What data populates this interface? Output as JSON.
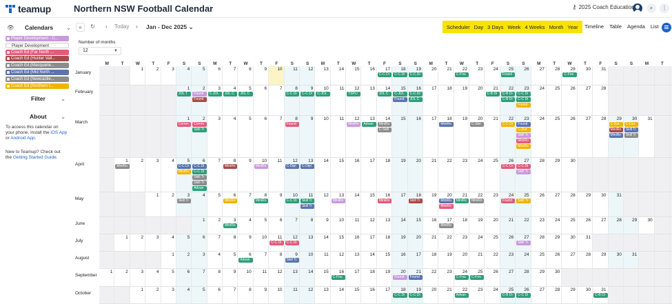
{
  "app": {
    "logo_text": "teamup",
    "title": "Northern NSW Football Calendar",
    "user": "2025 Coach Education"
  },
  "sidebar": {
    "calendars_label": "Calendars",
    "calendars": [
      {
        "name": "Player Development - C...",
        "color": "#c99adb"
      },
      {
        "name": "Player Development",
        "color": "#ffffff",
        "text": "#333"
      },
      {
        "name": "Coach Ed (Far North ...",
        "color": "#e35b7a"
      },
      {
        "name": "Coach Ed (Hunter Vall...",
        "color": "#a84a4a"
      },
      {
        "name": "Coach Ed (Macquarie...",
        "color": "#8c8c8c"
      },
      {
        "name": "Coach Ed (Mid North ...",
        "color": "#5a74ae"
      },
      {
        "name": "Coach Ed (Newcastle...",
        "color": "#8c8c8c"
      },
      {
        "name": "Coach Ed (Northern I...",
        "color": "#f0b400"
      }
    ],
    "filter_label": "Filter",
    "about_label": "About",
    "about_text1": "To access this calendar on your phone, install the ",
    "about_link1": "iOS App",
    "about_or": " or ",
    "about_link2": "Android App",
    "about_text2": "New to Teamup? Check out the ",
    "about_link3": "Getting Started Guide"
  },
  "toolbar": {
    "today": "Today",
    "range": "Jan - Dec 2025",
    "views_highlight": [
      "Scheduler",
      "Day",
      "3 Days",
      "Week",
      "4 Weeks",
      "Month",
      "Year"
    ],
    "views_other": [
      "Timeline",
      "Table",
      "Agenda",
      "List"
    ]
  },
  "months_control": {
    "label": "Number of months",
    "value": "12"
  },
  "day_headers": [
    "M",
    "T",
    "W",
    "T",
    "F",
    "S",
    "S",
    "M",
    "T",
    "W",
    "T",
    "F",
    "S",
    "S",
    "M",
    "T",
    "W",
    "T",
    "F",
    "S",
    "S",
    "M",
    "T",
    "W",
    "T",
    "F",
    "S",
    "S",
    "M",
    "T",
    "W",
    "T",
    "F",
    "S",
    "S",
    "M",
    "T",
    "W"
  ],
  "months": [
    {
      "name": "January",
      "offset": 2,
      "days": 31
    },
    {
      "name": "February",
      "offset": 5,
      "days": 28
    },
    {
      "name": "March",
      "offset": 5,
      "days": 31
    },
    {
      "name": "April",
      "offset": 1,
      "days": 30
    },
    {
      "name": "May",
      "offset": 3,
      "days": 31
    },
    {
      "name": "June",
      "offset": 6,
      "days": 30
    },
    {
      "name": "July",
      "offset": 1,
      "days": 31
    },
    {
      "name": "August",
      "offset": 4,
      "days": 31
    },
    {
      "name": "September",
      "offset": 0,
      "days": 30
    },
    {
      "name": "October",
      "offset": 2,
      "days": 31
    }
  ],
  "today": {
    "month": 0,
    "day": 10
  },
  "events": [
    {
      "m": 0,
      "d": 17,
      "t": "C-C Di",
      "c": "#2e9e78"
    },
    {
      "m": 0,
      "d": 18,
      "t": "C-C Di",
      "c": "#2e9e78"
    },
    {
      "m": 0,
      "d": 19,
      "t": "C-C Di",
      "c": "#2e9e78"
    },
    {
      "m": 0,
      "d": 22,
      "t": "C-Fou",
      "c": "#2e9e78"
    },
    {
      "m": 0,
      "d": 25,
      "t": "Found",
      "c": "#2e9e78"
    },
    {
      "m": 0,
      "d": 29,
      "t": "C-Fou",
      "c": "#2e9e78"
    },
    {
      "m": 1,
      "d": 1,
      "t": "JDL T",
      "c": "#2e9e78"
    },
    {
      "m": 1,
      "d": 2,
      "t": "Found",
      "c": "#c99adb"
    },
    {
      "m": 1,
      "d": 2,
      "t": "Found",
      "c": "#a84a4a",
      "r": 1
    },
    {
      "m": 1,
      "d": 3,
      "t": "C-JDL",
      "c": "#2e9e78"
    },
    {
      "m": 1,
      "d": 4,
      "t": "JDL C",
      "c": "#2e9e78"
    },
    {
      "m": 1,
      "d": 5,
      "t": "JDL C",
      "c": "#2e9e78"
    },
    {
      "m": 1,
      "d": 8,
      "t": "C-C Di",
      "c": "#2e9e78"
    },
    {
      "m": 1,
      "d": 9,
      "t": "C-C Di",
      "c": "#2e9e78"
    },
    {
      "m": 1,
      "d": 10,
      "t": "C-JDL",
      "c": "#2e9e78"
    },
    {
      "m": 1,
      "d": 12,
      "t": "TSP/J",
      "c": "#2e9e78"
    },
    {
      "m": 1,
      "d": 14,
      "t": "JDL C",
      "c": "#2e9e78"
    },
    {
      "m": 1,
      "d": 15,
      "t": "C-JDL",
      "c": "#2e9e78"
    },
    {
      "m": 1,
      "d": 15,
      "t": "Found",
      "c": "#5a74ae",
      "r": 1
    },
    {
      "m": 1,
      "d": 16,
      "t": "C-C Di",
      "c": "#2e9e78"
    },
    {
      "m": 1,
      "d": 16,
      "t": "JDL C",
      "c": "#2e9e78",
      "r": 1
    },
    {
      "m": 1,
      "d": 21,
      "t": "C-B Di",
      "c": "#2e9e78"
    },
    {
      "m": 1,
      "d": 22,
      "t": "C-B Di",
      "c": "#2e9e78"
    },
    {
      "m": 1,
      "d": 22,
      "t": "C-B Di",
      "c": "#2e9e78",
      "r": 1
    },
    {
      "m": 1,
      "d": 23,
      "t": "C-C Di",
      "c": "#2e9e78"
    },
    {
      "m": 1,
      "d": 23,
      "t": "C-C Di",
      "c": "#2e9e78",
      "r": 1
    },
    {
      "m": 1,
      "d": 23,
      "t": "Found",
      "c": "#f0b400",
      "r": 2
    },
    {
      "m": 2,
      "d": 1,
      "t": "Comm",
      "c": "#e35b7a"
    },
    {
      "m": 2,
      "d": 2,
      "t": "Comm",
      "c": "#e35b7a"
    },
    {
      "m": 2,
      "d": 2,
      "t": "Skill Tr",
      "c": "#2e9e78",
      "r": 1
    },
    {
      "m": 2,
      "d": 8,
      "t": "Found",
      "c": "#e35b7a"
    },
    {
      "m": 2,
      "d": 12,
      "t": "MiniRo",
      "c": "#c99adb"
    },
    {
      "m": 2,
      "d": 13,
      "t": "Advan",
      "c": "#2e9e78"
    },
    {
      "m": 2,
      "d": 14,
      "t": "MiniRo",
      "c": "#8c8c8c"
    },
    {
      "m": 2,
      "d": 14,
      "t": "C-Skill",
      "c": "#8c8c8c",
      "r": 1
    },
    {
      "m": 2,
      "d": 18,
      "t": "MiniRo",
      "c": "#5a74ae"
    },
    {
      "m": 2,
      "d": 20,
      "t": "C-Skil",
      "c": "#8c8c8c"
    },
    {
      "m": 2,
      "d": 22,
      "t": "C-C Di",
      "c": "#f0b400"
    },
    {
      "m": 2,
      "d": 23,
      "t": "Found",
      "c": "#5a74ae"
    },
    {
      "m": 2,
      "d": 23,
      "t": "C-Dut",
      "c": "#f0b400",
      "r": 1
    },
    {
      "m": 2,
      "d": 23,
      "t": "Skill Tr",
      "c": "#c99adb",
      "r": 2
    },
    {
      "m": 2,
      "d": 23,
      "t": "MiniRo",
      "c": "#e35b7a",
      "r": 3
    },
    {
      "m": 2,
      "d": 23,
      "t": "MiniRo",
      "c": "#f0b400",
      "r": 4
    },
    {
      "m": 2,
      "d": 29,
      "t": "C-Dut",
      "c": "#f0b400"
    },
    {
      "m": 2,
      "d": 29,
      "t": "MiniRo",
      "c": "#a84a4a",
      "r": 1
    },
    {
      "m": 2,
      "d": 29,
      "t": "MiniRo",
      "c": "#5a74ae",
      "r": 2
    },
    {
      "m": 2,
      "d": 30,
      "t": "C-Dut",
      "c": "#f0b400"
    },
    {
      "m": 2,
      "d": 30,
      "t": "Skill Tr",
      "c": "#5a74ae",
      "r": 1
    },
    {
      "m": 2,
      "d": 30,
      "t": "Skill Tr",
      "c": "#8c8c8c",
      "r": 2
    },
    {
      "m": 3,
      "d": 1,
      "t": "MiniRo",
      "c": "#8c8c8c"
    },
    {
      "m": 3,
      "d": 5,
      "t": "C-C Di",
      "c": "#5a74ae"
    },
    {
      "m": 3,
      "d": 5,
      "t": "MiniRo",
      "c": "#f0b400",
      "r": 1
    },
    {
      "m": 3,
      "d": 6,
      "t": "C-C Di",
      "c": "#5a74ae"
    },
    {
      "m": 3,
      "d": 6,
      "t": "C-C Di",
      "c": "#2e9e78",
      "r": 1
    },
    {
      "m": 3,
      "d": 6,
      "t": "Skill Tr",
      "c": "#8c8c8c",
      "r": 2
    },
    {
      "m": 3,
      "d": 6,
      "t": "Skill Tr",
      "c": "#8c8c8c",
      "r": 3
    },
    {
      "m": 3,
      "d": 6,
      "t": "Advan",
      "c": "#2e9e78",
      "r": 4
    },
    {
      "m": 3,
      "d": 8,
      "t": "MiniRo",
      "c": "#a84a4a"
    },
    {
      "m": 3,
      "d": 10,
      "t": "MiniRo",
      "c": "#c99adb"
    },
    {
      "m": 3,
      "d": 12,
      "t": "C-Dipl",
      "c": "#5a74ae"
    },
    {
      "m": 3,
      "d": 13,
      "t": "C-Dipl",
      "c": "#5a74ae"
    },
    {
      "m": 3,
      "d": 26,
      "t": "C-C Di",
      "c": "#e35b7a"
    },
    {
      "m": 3,
      "d": 27,
      "t": "C-C Di",
      "c": "#e35b7a"
    },
    {
      "m": 3,
      "d": 27,
      "t": "Skill Tr",
      "c": "#c99adb",
      "r": 1
    },
    {
      "m": 4,
      "d": 3,
      "t": "Skill Tr",
      "c": "#8c8c8c"
    },
    {
      "m": 4,
      "d": 6,
      "t": "MiniRo",
      "c": "#f0b400"
    },
    {
      "m": 4,
      "d": 8,
      "t": "MiniRo",
      "c": "#2e9e78"
    },
    {
      "m": 4,
      "d": 10,
      "t": "C-C Di",
      "c": "#2e9e78"
    },
    {
      "m": 4,
      "d": 11,
      "t": "Skill Tr",
      "c": "#2e9e78"
    },
    {
      "m": 4,
      "d": 11,
      "t": "Skill Tr",
      "c": "#5a74ae",
      "r": 1
    },
    {
      "m": 4,
      "d": 13,
      "t": "MiniRo",
      "c": "#c99adb"
    },
    {
      "m": 4,
      "d": 16,
      "t": "MiniRo",
      "c": "#e35b7a"
    },
    {
      "m": 4,
      "d": 18,
      "t": "Skill Tr",
      "c": "#a84a4a"
    },
    {
      "m": 4,
      "d": 20,
      "t": "MiniRo",
      "c": "#5a74ae"
    },
    {
      "m": 4,
      "d": 20,
      "t": "MiniRo",
      "c": "#e35b7a",
      "r": 1
    },
    {
      "m": 4,
      "d": 21,
      "t": "MiniRo",
      "c": "#2e9e78"
    },
    {
      "m": 4,
      "d": 22,
      "t": "MiniRo",
      "c": "#8c8c8c"
    },
    {
      "m": 4,
      "d": 24,
      "t": "Found",
      "c": "#e35b7a"
    },
    {
      "m": 4,
      "d": 25,
      "t": "Skill Tr",
      "c": "#f0b400"
    },
    {
      "m": 5,
      "d": 3,
      "t": "MiniRo",
      "c": "#2e9e78"
    },
    {
      "m": 5,
      "d": 17,
      "t": "MiniRo",
      "c": "#8c8c8c"
    },
    {
      "m": 6,
      "d": 11,
      "t": "C-C Di",
      "c": "#e35b7a"
    },
    {
      "m": 6,
      "d": 12,
      "t": "C-C Di",
      "c": "#e35b7a"
    },
    {
      "m": 6,
      "d": 27,
      "t": "Skill Tr",
      "c": "#c99adb"
    },
    {
      "m": 7,
      "d": 6,
      "t": "Advan",
      "c": "#2e9e78"
    },
    {
      "m": 7,
      "d": 9,
      "t": "Skill Tr",
      "c": "#5a74ae"
    },
    {
      "m": 8,
      "d": 16,
      "t": "C-Fou",
      "c": "#2e9e78"
    },
    {
      "m": 8,
      "d": 20,
      "t": "Found",
      "c": "#c99adb"
    },
    {
      "m": 8,
      "d": 21,
      "t": "Found",
      "c": "#5a74ae"
    },
    {
      "m": 8,
      "d": 24,
      "t": "C-Fou",
      "c": "#2e9e78"
    },
    {
      "m": 8,
      "d": 25,
      "t": "C-Fou",
      "c": "#2e9e78"
    },
    {
      "m": 9,
      "d": 18,
      "t": "C-C Di",
      "c": "#2e9e78"
    },
    {
      "m": 9,
      "d": 19,
      "t": "C-C Di",
      "c": "#2e9e78"
    },
    {
      "m": 9,
      "d": 22,
      "t": "Advan",
      "c": "#2e9e78"
    },
    {
      "m": 9,
      "d": 25,
      "t": "C-B Di",
      "c": "#2e9e78"
    },
    {
      "m": 9,
      "d": 26,
      "t": "C-C Di",
      "c": "#2e9e78"
    },
    {
      "m": 9,
      "d": 31,
      "t": "C-B Di",
      "c": "#2e9e78"
    }
  ]
}
